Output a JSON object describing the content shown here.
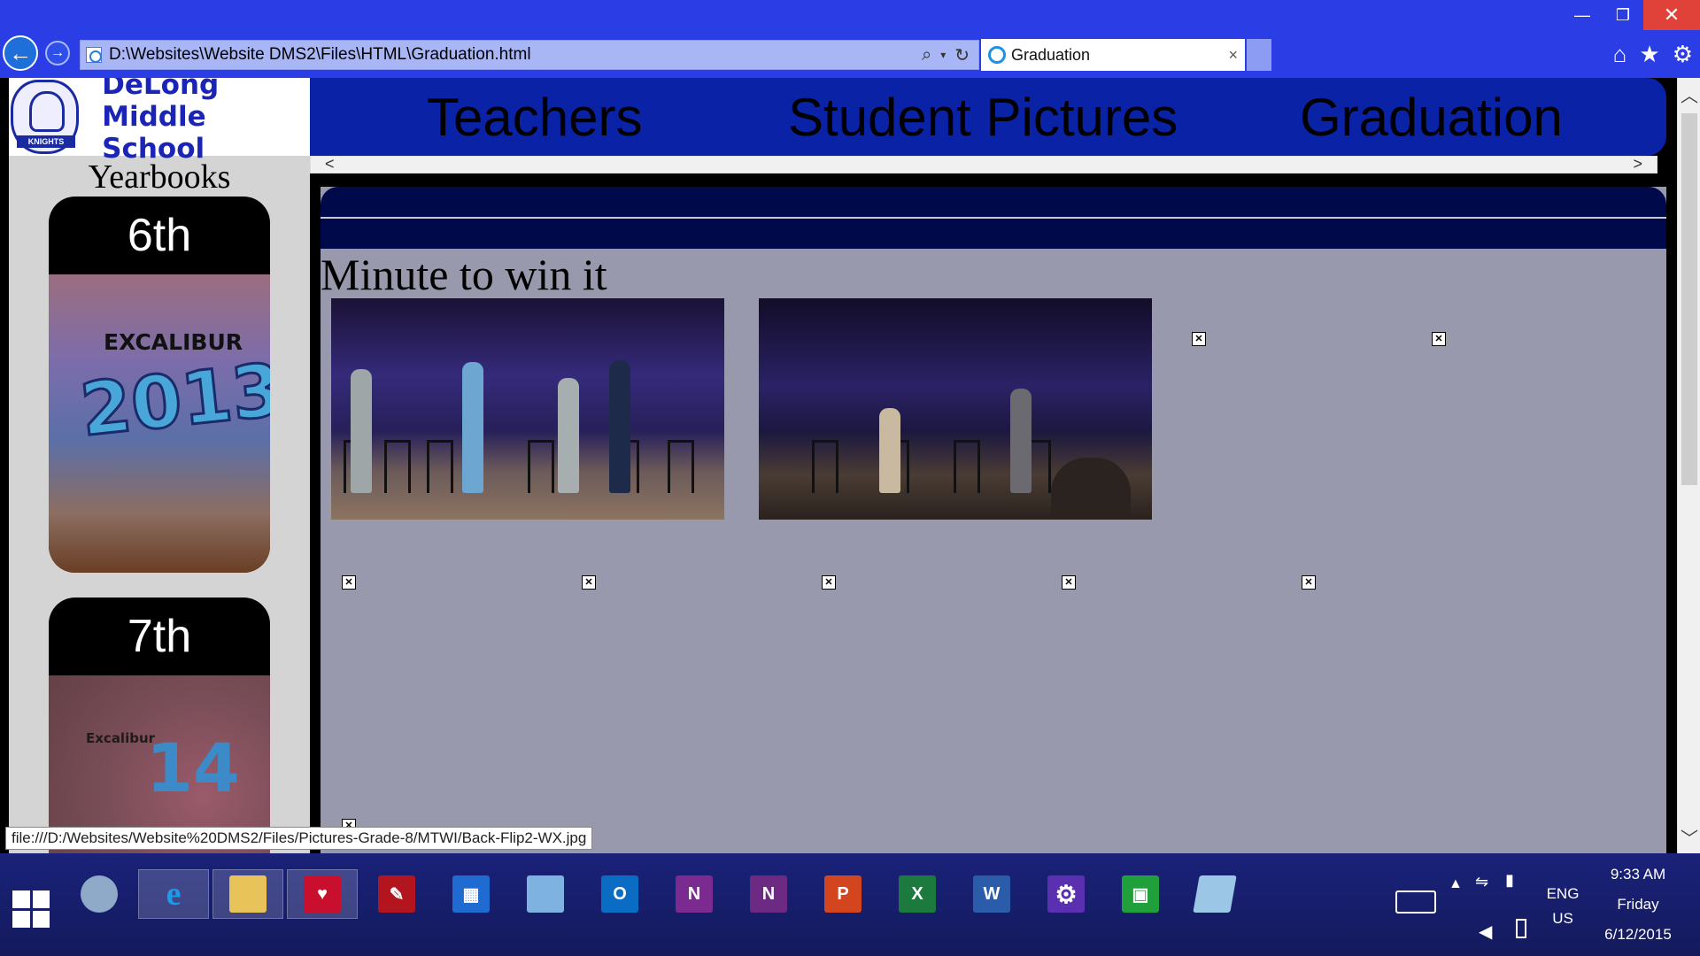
{
  "browser": {
    "url": "D:\\Websites\\Website DMS2\\Files\\HTML\\Graduation.html",
    "tab_title": "Graduation",
    "tab_close": "×",
    "back_glyph": "←",
    "forward_glyph": "→",
    "search_glyph": "⌕",
    "refresh_glyph": "↻",
    "min_glyph": "—",
    "restore_glyph": "❐",
    "close_glyph": "✕",
    "home_glyph": "⌂",
    "fav_glyph": "★",
    "settings_glyph": "⚙"
  },
  "site": {
    "school_name_line1": "DeLong",
    "school_name_line2": "Middle School",
    "logo_ribbon": "KNIGHTS",
    "nav": [
      "Teachers",
      "Student Pictures",
      "Graduation"
    ],
    "yearbooks_title": "Yearbooks",
    "yearbooks": [
      {
        "label": "6th",
        "cover_word": "EXCALIBUR",
        "cover_year": "2013"
      },
      {
        "label": "7th",
        "cover_word": "Excalibur",
        "cover_year": "14"
      }
    ],
    "section_title": "Minute to win it",
    "broken_image_glyph": "✕"
  },
  "status_url": "file:///D:/Websites/Website%20DMS2/Files/Pictures-Grade-8/MTWI/Back-Flip2-WX.jpg",
  "taskbar": {
    "icons": [
      "performance-monitor",
      "internet-explorer",
      "file-explorer",
      "iheartradio",
      "acrobat",
      "windows-store-tiles",
      "remote-desktop",
      "outlook",
      "onenote",
      "onenote-clipper",
      "powerpoint",
      "excel",
      "word",
      "settings",
      "store",
      "notepad"
    ],
    "labels": {
      "outlook": "O",
      "onenote": "N",
      "onenote_clipper": "N",
      "powerpoint": "P",
      "excel": "X",
      "word": "W"
    },
    "tray": {
      "lang_line1": "ENG",
      "lang_line2": "US",
      "time": "9:33 AM",
      "day": "Friday",
      "date": "6/12/2015"
    }
  },
  "colors": {
    "chrome_blue": "#2b3ee6",
    "nav_blue": "#0a22a6",
    "content_gray": "#9899ad",
    "school_text": "#1a25b8"
  }
}
